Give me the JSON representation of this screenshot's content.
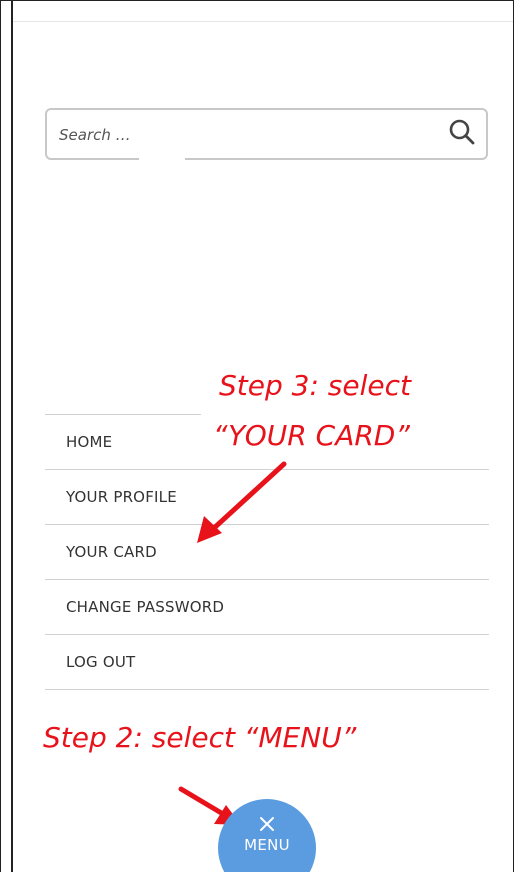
{
  "search": {
    "placeholder": "Search …"
  },
  "menu": {
    "items": [
      {
        "label": "HOME"
      },
      {
        "label": "YOUR PROFILE"
      },
      {
        "label": "YOUR CARD"
      },
      {
        "label": "CHANGE PASSWORD"
      },
      {
        "label": "LOG OUT"
      }
    ]
  },
  "fab": {
    "label": "MENU",
    "icon": "close-icon"
  },
  "annotations": {
    "step3_line1": "Step 3: select",
    "step3_line2": "“YOUR CARD”",
    "step2": "Step 2: select “MENU”"
  },
  "colors": {
    "annotation": "#e8121b",
    "fab": "#5b9be0",
    "border": "#c8c8c8"
  }
}
